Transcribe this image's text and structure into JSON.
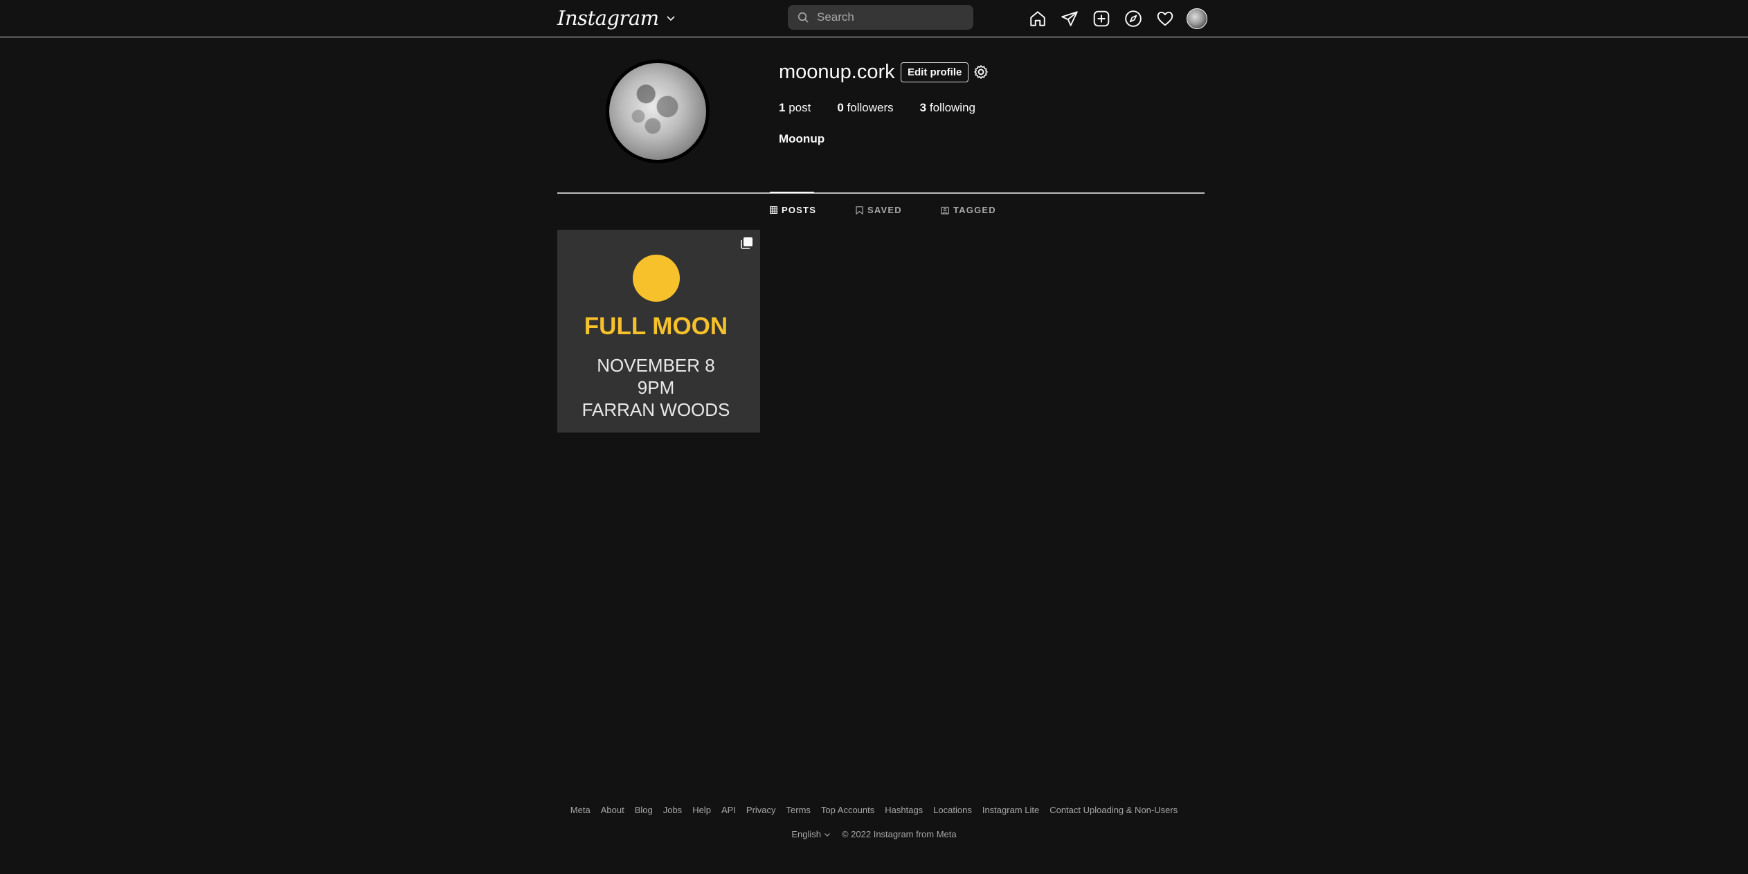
{
  "topbar": {
    "logo_text": "Instagram",
    "search": {
      "placeholder": "Search",
      "value": ""
    },
    "nav_icons": [
      "home-icon",
      "direct-messages-icon",
      "new-post-icon",
      "explore-icon",
      "activity-heart-icon",
      "profile-avatar"
    ]
  },
  "profile": {
    "username": "moonup.cork",
    "edit_label": "Edit profile",
    "stats": {
      "posts_count": "1",
      "posts_label": "post",
      "followers_count": "0",
      "followers_label": "followers",
      "following_count": "3",
      "following_label": "following"
    },
    "full_name": "Moonup"
  },
  "tabs": [
    {
      "label": "POSTS",
      "icon": "grid-icon",
      "active": true
    },
    {
      "label": "SAVED",
      "icon": "bookmark-icon",
      "active": false
    },
    {
      "label": "TAGGED",
      "icon": "tagged-icon",
      "active": false
    }
  ],
  "post": {
    "title": "FULL MOON",
    "line1": "NOVEMBER 8",
    "line2": "9PM",
    "line3": "FARRAN WOODS",
    "accent_color": "#f6c12a"
  },
  "footer": {
    "links": [
      "Meta",
      "About",
      "Blog",
      "Jobs",
      "Help",
      "API",
      "Privacy",
      "Terms",
      "Top Accounts",
      "Hashtags",
      "Locations",
      "Instagram Lite",
      "Contact Uploading & Non-Users"
    ],
    "language": "English",
    "copyright": "© 2022 Instagram from Meta"
  },
  "colors": {
    "background": "#121212",
    "text": "#f5f5f5",
    "muted": "#a8a8a8",
    "divider": "#dbdbdb"
  }
}
